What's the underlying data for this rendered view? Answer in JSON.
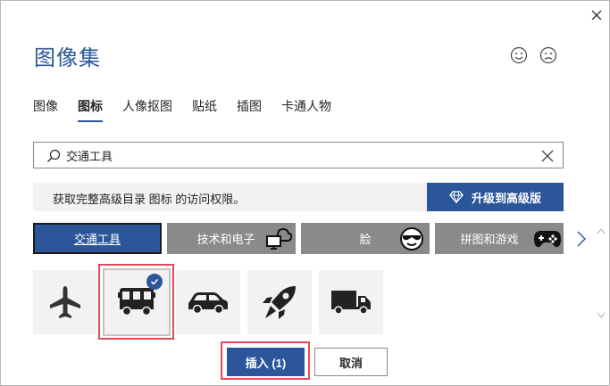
{
  "dialog": {
    "title": "图像集",
    "close_icon": "close-icon",
    "feedback": {
      "smile_icon": "smile-icon",
      "frown_icon": "frown-icon"
    }
  },
  "tabs": [
    {
      "label": "图像",
      "active": false
    },
    {
      "label": "图标",
      "active": true
    },
    {
      "label": "人像抠图",
      "active": false
    },
    {
      "label": "贴纸",
      "active": false
    },
    {
      "label": "插图",
      "active": false
    },
    {
      "label": "卡通人物",
      "active": false
    }
  ],
  "search": {
    "value": "交通工具",
    "search_icon": "search-icon",
    "clear_icon": "clear-icon"
  },
  "upgrade": {
    "message": "获取完整高级目录 图标 的访问权限。",
    "button_label": "升级到高级版",
    "button_icon": "diamond-icon"
  },
  "categories": [
    {
      "label": "交通工具",
      "active": true,
      "icon": ""
    },
    {
      "label": "技术和电子",
      "active": false,
      "icon": "cloud-monitor-icon"
    },
    {
      "label": "脸",
      "active": false,
      "icon": "sunglasses-face-icon"
    },
    {
      "label": "拼图和游戏",
      "active": false,
      "icon": "gamepad-icon"
    }
  ],
  "icon_results": [
    {
      "name": "airplane-icon",
      "selected": false
    },
    {
      "name": "bus-icon",
      "selected": true
    },
    {
      "name": "car-icon",
      "selected": false
    },
    {
      "name": "rocket-icon",
      "selected": false
    },
    {
      "name": "truck-icon",
      "selected": false
    }
  ],
  "buttons": {
    "insert_label": "插入 (1)",
    "cancel_label": "取消"
  },
  "colors": {
    "accent": "#2b579a",
    "highlight": "#e24b5a",
    "category_inactive": "#8a8a8a",
    "tile_bg": "#f3f2f1"
  }
}
